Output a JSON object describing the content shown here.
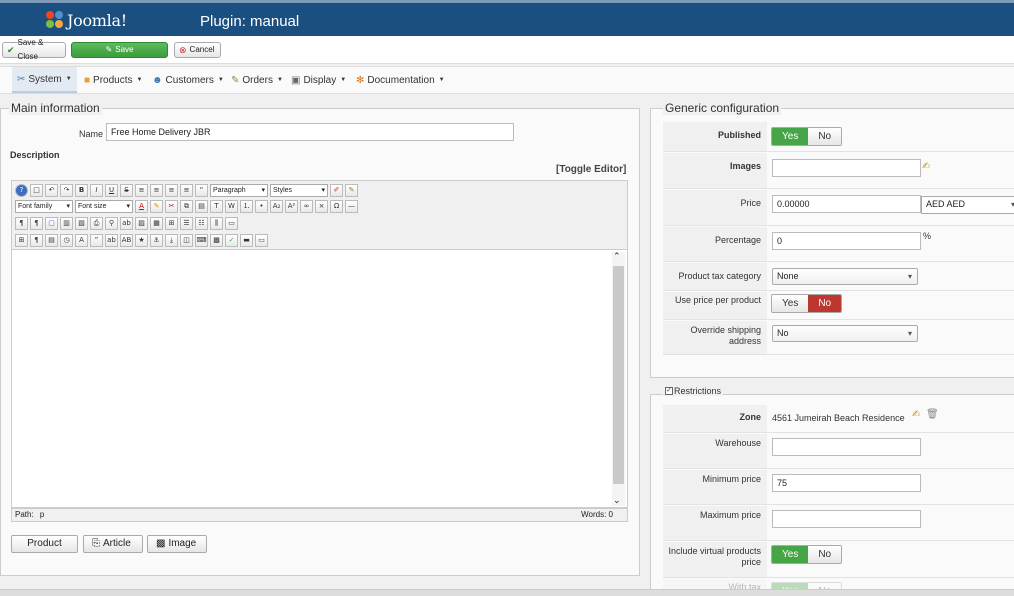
{
  "header": {
    "logo_text": "Joomla!",
    "title": "Plugin: manual"
  },
  "toolbar": {
    "save_close": "Save & Close",
    "save": "Save",
    "cancel": "Cancel"
  },
  "menu": [
    "System",
    "Products",
    "Customers",
    "Orders",
    "Display",
    "Documentation"
  ],
  "main": {
    "legend": "Main information",
    "name_label": "Name",
    "name_value": "Free Home Delivery JBR",
    "description_label": "Description",
    "toggle_editor": "[Toggle Editor]",
    "editor": {
      "paragraph": "Paragraph",
      "styles": "Styles",
      "font_family": "Font family",
      "font_size": "Font size",
      "path": "Path:",
      "path_value": "p",
      "words": "Words: 0"
    },
    "buttons": {
      "product": "Product",
      "article": "Article",
      "image": "Image"
    }
  },
  "generic": {
    "legend": "Generic configuration",
    "published_label": "Published",
    "yes": "Yes",
    "no": "No",
    "images_label": "Images",
    "price_label": "Price",
    "price_value": "0.00000",
    "currency": "AED AED",
    "percentage_label": "Percentage",
    "percentage_value": "0",
    "percent_sign": "%",
    "tax_label": "Product tax category",
    "tax_value": "None",
    "price_per_product_label": "Use price per product",
    "override_label": "Override shipping address",
    "override_value": "No"
  },
  "restrictions": {
    "legend": "Restrictions",
    "zone_label": "Zone",
    "zone_value": "4561 Jumeirah Beach Residence",
    "warehouse_label": "Warehouse",
    "min_price_label": "Minimum price",
    "min_price_value": "75",
    "max_price_label": "Maximum price",
    "virtual_label": "Include virtual products price",
    "with_tax_label": "With tax"
  },
  "colors": {
    "header": "#1a4f80",
    "yes_green": "#46a546",
    "no_red": "#bd362f"
  }
}
